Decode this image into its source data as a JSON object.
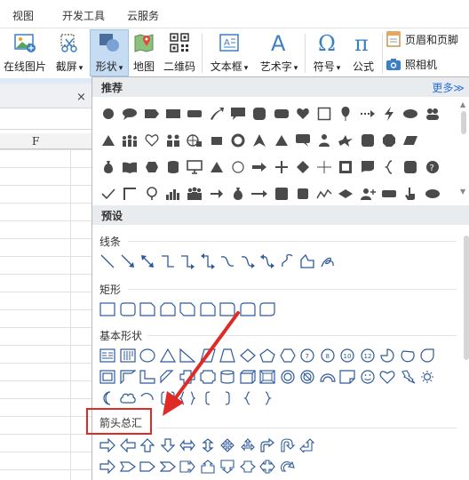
{
  "menu": {
    "view": "视图",
    "devtools": "开发工具",
    "cloud": "云服务"
  },
  "ribbon": {
    "online_image": "在线图片",
    "screenshot": "截屏",
    "shapes": "形状",
    "map": "地图",
    "qrcode": "二维码",
    "textbox": "文本框",
    "wordart": "艺术字",
    "symbol": "符号",
    "formula": "公式",
    "header_footer": "页眉和页脚",
    "camera": "照相机",
    "dropdown_caret": "▾"
  },
  "sheet": {
    "column_label": "F",
    "close": "×"
  },
  "panel": {
    "recommended": "推荐",
    "more": "更多≫",
    "presets": "预设",
    "lines": "线条",
    "rectangles": "矩形",
    "basic_shapes": "基本形状",
    "arrows_summary": "箭头总汇"
  },
  "colors": {
    "accent": "#2b6fd6",
    "highlight_border": "#e02a25",
    "icon_outline": "#2f5b9a",
    "shape_fill": "#4a4a4a",
    "active_button": "#c5dcf3"
  },
  "icons": [
    "image-icon",
    "scissors-icon",
    "shapes-icon",
    "map-pin-icon",
    "qrcode-icon",
    "textbox-icon",
    "wordart-a-icon",
    "omega-icon",
    "pi-icon",
    "header-footer-icon",
    "camera-icon"
  ]
}
